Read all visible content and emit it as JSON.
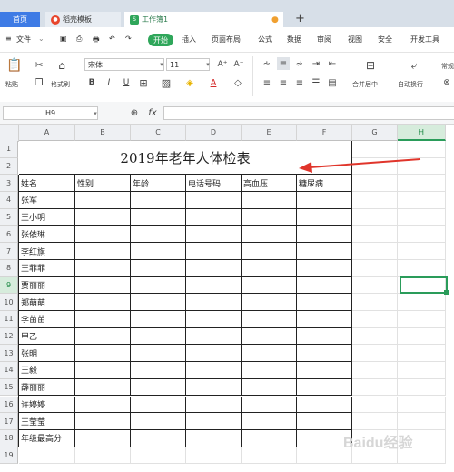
{
  "tabs": [
    {
      "label": "首页"
    },
    {
      "label": "稻壳模板"
    },
    {
      "label": "工作簿1"
    }
  ],
  "tab_add": "+",
  "menu": {
    "file": "文件",
    "start": "开始",
    "items": [
      "插入",
      "页面布局",
      "公式",
      "数据",
      "审阅",
      "视图",
      "安全",
      "开发工具"
    ]
  },
  "toolbar": {
    "paste": "粘贴",
    "format_painter": "格式刷",
    "font_name": "宋体",
    "font_size": "11",
    "bold": "B",
    "italic": "I",
    "underline": "U",
    "grow": "A⁺",
    "shrink": "A⁻",
    "merge": "合并居中",
    "wrap": "自动换行",
    "general": "常规"
  },
  "formula": {
    "cell_ref": "H9",
    "fx": "fx",
    "value": ""
  },
  "grid": {
    "columns": [
      "A",
      "B",
      "C",
      "D",
      "E",
      "F",
      "G",
      "H"
    ],
    "rows": [
      "1",
      "2",
      "3",
      "4",
      "5",
      "6",
      "7",
      "8",
      "9",
      "10",
      "11",
      "12",
      "13",
      "14",
      "15",
      "16",
      "17",
      "18",
      "19"
    ],
    "title": "2019年老年人体检表",
    "headers": [
      "姓名",
      "性别",
      "年龄",
      "电话号码",
      "高血压",
      "糖尿病"
    ],
    "names": [
      "张军",
      "王小明",
      "张依琳",
      "李红旗",
      "王菲菲",
      "贾丽丽",
      "郑萌萌",
      "李苗苗",
      "甲乙",
      "张明",
      "王毅",
      "薛丽丽",
      "许婷婷",
      "王莹莹",
      "年级最高分"
    ],
    "selected_col": "H",
    "selected_row": "9"
  },
  "colors": {
    "accent": "#2a9c5a",
    "arrow": "#e0352b",
    "tab_home": "#3e7be5"
  },
  "watermark": "Baidu经验"
}
